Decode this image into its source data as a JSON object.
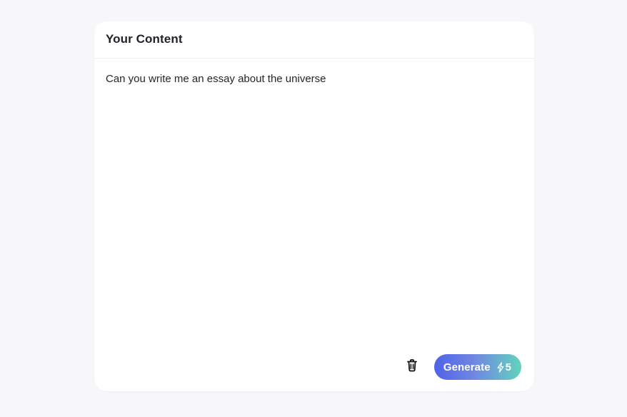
{
  "card": {
    "title": "Your Content",
    "content_value": "Can you write me an essay about the universe"
  },
  "actions": {
    "delete_icon": "trash-icon",
    "generate_label": "Generate",
    "cost_icon": "lightning-icon",
    "cost_value": "5"
  },
  "colors": {
    "background": "#f7f7f9",
    "card": "#ffffff",
    "button_gradient_start": "#4f63e8",
    "button_gradient_end": "#63d3bd"
  }
}
